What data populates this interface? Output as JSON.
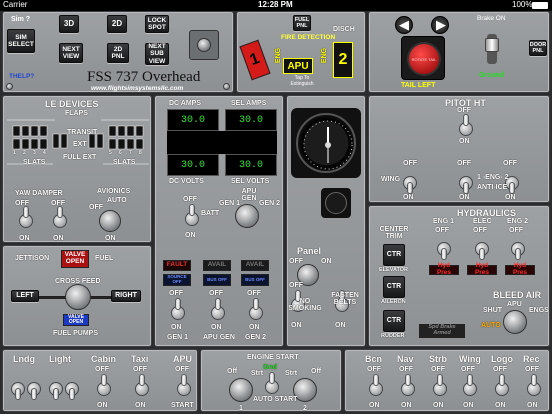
{
  "status_bar": {
    "carrier": "Carrier",
    "time": "12:28 PM",
    "battery": "100%"
  },
  "top_left": {
    "sim_label": "Sim ?",
    "sim_select": "SIM SELECT",
    "help": "THELP?",
    "btn_3d": "3D",
    "btn_2d": "2D",
    "btn_lock_spot": "LOCK SPOT",
    "btn_next_view": "NEXT VIEW",
    "btn_2d_pnl": "2D PNL",
    "btn_next_sub_view": "NEXT SUB VIEW",
    "title": "FSS 737 Overhead",
    "website": "www.flightsimsystemsllc.com"
  },
  "fire": {
    "fuel_pnl": "FUEL PNL",
    "fire_detection": "FIRE DETECTION",
    "eng1": "1",
    "eng2": "2",
    "apu": "APU",
    "disch": "DISCH",
    "tap": "Tap To Extinguish",
    "eng_lbl_left": "ENG",
    "eng_lbl_right": "ENG"
  },
  "top_right": {
    "brake": "Brake ON",
    "tail": "TAIL LEFT",
    "door_pnl": "DOOR PNL",
    "button_label": "ROTATE TAIL",
    "status": "Ground"
  },
  "le_devices": {
    "title": "LE DEVICES",
    "flaps": "FLAPS",
    "transit": "TRANSIT",
    "ext": "EXT",
    "full_ext": "FULL EXT",
    "slats_left": "SLATS",
    "slats_right": "SLATS",
    "numbers": [
      "1",
      "2",
      "3",
      "4",
      "5",
      "6",
      "7",
      "8"
    ]
  },
  "yaw": {
    "label": "YAW DAMPER",
    "off": "OFF",
    "on": "ON"
  },
  "avionics": {
    "label": "AVIONICS",
    "auto": "AUTO",
    "off": "OFF",
    "on": "ON"
  },
  "fuel": {
    "jettison": "JETTISON",
    "valve": "VALVE OPEN",
    "fuel": "FUEL",
    "cross_feed": "CROSS FEED",
    "left": "LEFT",
    "right": "RIGHT",
    "valve_open": "VALVE OPEN",
    "pumps": "FUEL PUMPS"
  },
  "electrical": {
    "dc_amps": "DC AMPS",
    "sel_amps": "SEL AMPS",
    "amps_left": "30.0",
    "amps_right": "30.0",
    "dc_volts": "DC VOLTS",
    "sel_volts": "SEL VOLTS",
    "volts_left": "30.0",
    "volts_right": "30.0",
    "batt": "BATT",
    "off": "OFF",
    "on": "ON",
    "apu_gen": "APU GEN",
    "gen1": "GEN 1",
    "gen2": "GEN 2",
    "fault": "FAULT",
    "avail1": "AVAIL",
    "avail2": "AVAIL",
    "src_off": "SOURCE OFF",
    "bus_off1": "BUS OFF",
    "bus_off2": "BUS OFF",
    "gen1_label": "GEN 1",
    "apu_gen_label": "APU GEN",
    "gen2_label": "GEN 2"
  },
  "panel_switches": {
    "panel": "Panel",
    "off": "OFF",
    "on": "ON",
    "no_smoking": "NO SMOKING",
    "fasten_belts": "FASTEN BELTS"
  },
  "pitot": {
    "title": "PITOT HT",
    "off": "OFF",
    "on": "ON",
    "wing": "WING",
    "eng": "1 -ENG- 2",
    "anti_ice": "ANTI-ICE"
  },
  "hydraulics": {
    "title": "HYDRAULICS",
    "center_trim": "CENTER TRIM",
    "ctr": "CTR",
    "elevator": "ELEVATOR",
    "aileron": "AILERON",
    "rudder": "RUDDER",
    "eng1": "ENG 1",
    "elec": "ELEC",
    "eng2": "ENG 2",
    "off": "OFF",
    "hyd_pres": "Hyd Pres",
    "spd_brake": "Spd Brake Armed",
    "bleed_air": "BLEED AIR",
    "apu": "APU",
    "shut": "SHUT",
    "engs": "ENGS",
    "auto": "AUTO"
  },
  "lights": {
    "lndg": "Lndg",
    "light": "Light",
    "cabin": "Cabin",
    "taxi": "Taxi",
    "apu": "APU",
    "off": "OFF",
    "on": "ON",
    "start": "START"
  },
  "engine_start": {
    "title": "ENGINE START",
    "off": "Off",
    "strt": "Strt",
    "gnd": "Gnd",
    "auto_start": "AUTO START",
    "one": "1",
    "two": "2"
  },
  "right_lights": {
    "bcn": "Bcn",
    "nav": "Nav",
    "strb": "Strb",
    "wing": "Wing",
    "logo": "Logo",
    "rec": "Rec",
    "off": "OFF",
    "on": "ON"
  },
  "colors": {
    "panel": "#9a9da0",
    "lcd_green": "#35e035",
    "warning_red": "#e63030",
    "ground_green": "#22dd22"
  }
}
